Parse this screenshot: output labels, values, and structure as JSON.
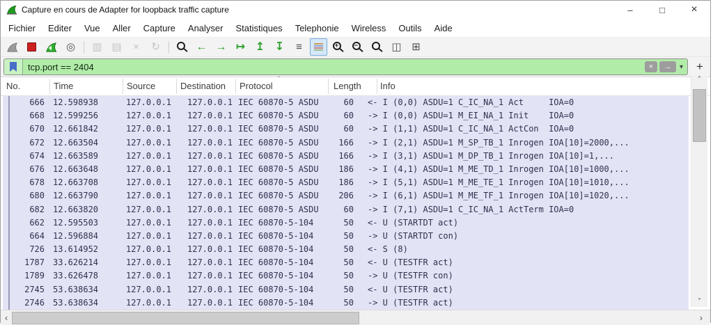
{
  "window": {
    "title": "Capture en cours de Adapter for loopback traffic capture",
    "minimize": "–",
    "maximize": "□",
    "close": "×"
  },
  "menu": {
    "items": [
      "Fichier",
      "Editer",
      "Vue",
      "Aller",
      "Capture",
      "Analyser",
      "Statistiques",
      "Telephonie",
      "Wireless",
      "Outils",
      "Aide"
    ]
  },
  "toolbar": {
    "icons": [
      {
        "name": "capture-start-icon",
        "glyph": ""
      },
      {
        "name": "capture-stop-icon",
        "glyph": ""
      },
      {
        "name": "capture-restart-icon",
        "glyph": ""
      },
      {
        "name": "capture-options-icon",
        "glyph": "◎"
      },
      {
        "name": "open-file-icon",
        "glyph": "▥"
      },
      {
        "name": "save-file-icon",
        "glyph": "▤"
      },
      {
        "name": "close-capture-icon",
        "glyph": "×"
      },
      {
        "name": "reload-icon",
        "glyph": "↻"
      },
      {
        "name": "find-packet-icon",
        "glyph": ""
      },
      {
        "name": "go-back-icon",
        "glyph": "←"
      },
      {
        "name": "go-forward-icon",
        "glyph": "→"
      },
      {
        "name": "go-to-packet-icon",
        "glyph": "↦"
      },
      {
        "name": "go-first-icon",
        "glyph": "↥"
      },
      {
        "name": "go-last-icon",
        "glyph": "↧"
      },
      {
        "name": "auto-scroll-icon",
        "glyph": "≡"
      },
      {
        "name": "colorize-icon",
        "glyph": ""
      },
      {
        "name": "zoom-in-icon",
        "glyph": "+"
      },
      {
        "name": "zoom-out-icon",
        "glyph": "−"
      },
      {
        "name": "zoom-reset-icon",
        "glyph": ""
      },
      {
        "name": "resize-columns-icon",
        "glyph": "◫"
      },
      {
        "name": "reset-layout-icon",
        "glyph": "⊞"
      }
    ]
  },
  "filter": {
    "value": "tcp.port == 2404",
    "clear": "×",
    "apply": "→",
    "dropdown": "▾",
    "add": "+",
    "valid_bg": "#b2eca9"
  },
  "packet_table": {
    "columns": [
      "No.",
      "Time",
      "Source",
      "Destination",
      "Protocol",
      "Length",
      "Info"
    ],
    "sort_column": "Protocol",
    "sort_indicator": "ˆ",
    "row_bg": "#e3e3f6",
    "rows": [
      {
        "no": "666",
        "time": "12.598938",
        "source": "127.0.0.1",
        "destination": "127.0.0.1",
        "protocol": "IEC 60870-5 ASDU",
        "length": "60",
        "info": "<- I (0,0) ASDU=1 C_IC_NA_1 Act     IOA=0"
      },
      {
        "no": "668",
        "time": "12.599256",
        "source": "127.0.0.1",
        "destination": "127.0.0.1",
        "protocol": "IEC 60870-5 ASDU",
        "length": "60",
        "info": "-> I (0,0) ASDU=1 M_EI_NA_1 Init    IOA=0"
      },
      {
        "no": "670",
        "time": "12.661842",
        "source": "127.0.0.1",
        "destination": "127.0.0.1",
        "protocol": "IEC 60870-5 ASDU",
        "length": "60",
        "info": "-> I (1,1) ASDU=1 C_IC_NA_1 ActCon  IOA=0"
      },
      {
        "no": "672",
        "time": "12.663504",
        "source": "127.0.0.1",
        "destination": "127.0.0.1",
        "protocol": "IEC 60870-5 ASDU",
        "length": "166",
        "info": "-> I (2,1) ASDU=1 M_SP_TB_1 Inrogen IOA[10]=2000,..."
      },
      {
        "no": "674",
        "time": "12.663589",
        "source": "127.0.0.1",
        "destination": "127.0.0.1",
        "protocol": "IEC 60870-5 ASDU",
        "length": "166",
        "info": "-> I (3,1) ASDU=1 M_DP_TB_1 Inrogen IOA[10]=1,..."
      },
      {
        "no": "676",
        "time": "12.663648",
        "source": "127.0.0.1",
        "destination": "127.0.0.1",
        "protocol": "IEC 60870-5 ASDU",
        "length": "186",
        "info": "-> I (4,1) ASDU=1 M_ME_TD_1 Inrogen IOA[10]=1000,..."
      },
      {
        "no": "678",
        "time": "12.663708",
        "source": "127.0.0.1",
        "destination": "127.0.0.1",
        "protocol": "IEC 60870-5 ASDU",
        "length": "186",
        "info": "-> I (5,1) ASDU=1 M_ME_TE_1 Inrogen IOA[10]=1010,..."
      },
      {
        "no": "680",
        "time": "12.663790",
        "source": "127.0.0.1",
        "destination": "127.0.0.1",
        "protocol": "IEC 60870-5 ASDU",
        "length": "206",
        "info": "-> I (6,1) ASDU=1 M_ME_TF_1 Inrogen IOA[10]=1020,..."
      },
      {
        "no": "682",
        "time": "12.663820",
        "source": "127.0.0.1",
        "destination": "127.0.0.1",
        "protocol": "IEC 60870-5 ASDU",
        "length": "60",
        "info": "-> I (7,1) ASDU=1 C_IC_NA_1 ActTerm IOA=0"
      },
      {
        "no": "662",
        "time": "12.595503",
        "source": "127.0.0.1",
        "destination": "127.0.0.1",
        "protocol": "IEC 60870-5-104",
        "length": "50",
        "info": "<- U (STARTDT act)"
      },
      {
        "no": "664",
        "time": "12.596884",
        "source": "127.0.0.1",
        "destination": "127.0.0.1",
        "protocol": "IEC 60870-5-104",
        "length": "50",
        "info": "-> U (STARTDT con)"
      },
      {
        "no": "726",
        "time": "13.614952",
        "source": "127.0.0.1",
        "destination": "127.0.0.1",
        "protocol": "IEC 60870-5-104",
        "length": "50",
        "info": "<- S (8)"
      },
      {
        "no": "1787",
        "time": "33.626214",
        "source": "127.0.0.1",
        "destination": "127.0.0.1",
        "protocol": "IEC 60870-5-104",
        "length": "50",
        "info": "<- U (TESTFR act)"
      },
      {
        "no": "1789",
        "time": "33.626478",
        "source": "127.0.0.1",
        "destination": "127.0.0.1",
        "protocol": "IEC 60870-5-104",
        "length": "50",
        "info": "-> U (TESTFR con)"
      },
      {
        "no": "2745",
        "time": "53.638634",
        "source": "127.0.0.1",
        "destination": "127.0.0.1",
        "protocol": "IEC 60870-5-104",
        "length": "50",
        "info": "<- U (TESTFR act)"
      },
      {
        "no": "2746",
        "time": "53.638634",
        "source": "127.0.0.1",
        "destination": "127.0.0.1",
        "protocol": "IEC 60870-5-104",
        "length": "50",
        "info": "-> U (TESTFR act)"
      }
    ]
  },
  "scrollbars": {
    "up": "ˆ",
    "down": "ˇ",
    "left": "‹",
    "right": "›"
  },
  "colors": {
    "filter_valid_bg": "#b2eca9",
    "row_bg": "#e3e3f6",
    "accent_green": "#2ca02c",
    "stop_red": "#cc1f1f"
  }
}
